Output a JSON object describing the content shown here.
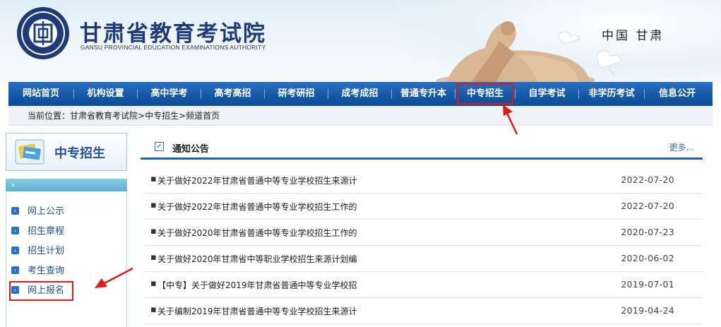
{
  "header": {
    "site_title": "甘肃省教育考试院",
    "site_subtitle": "GANSU PROVINCIAL EDUCATION EXAMINATIONS AUTHORITY",
    "region": "中国  甘肃",
    "logo_icon": "institution-seal-icon"
  },
  "nav": {
    "items": [
      {
        "label": "网站首页"
      },
      {
        "label": "机构设置"
      },
      {
        "label": "高中学考"
      },
      {
        "label": "高考高招"
      },
      {
        "label": "研考研招"
      },
      {
        "label": "成考成招"
      },
      {
        "label": "普通专升本"
      },
      {
        "label": "中专招生"
      },
      {
        "label": "自学考试"
      },
      {
        "label": "非学历考试"
      },
      {
        "label": "信息公开"
      }
    ],
    "active_index": 7
  },
  "breadcrumb": {
    "prefix": "当前位置：",
    "trail": "甘肃省教育考试院>中专招生>频道首页"
  },
  "sidebar": {
    "title": "中专招生",
    "items": [
      {
        "label": "网上公示"
      },
      {
        "label": "招生章程"
      },
      {
        "label": "招生计划"
      },
      {
        "label": "考生查询"
      },
      {
        "label": "网上报名"
      }
    ],
    "highlight_index": 4
  },
  "notices": {
    "title": "通知公告",
    "more": "更多...",
    "rows": [
      {
        "title": "关于做好2022年甘肃省普通中等专业学校招生来源计",
        "date": "2022-07-20"
      },
      {
        "title": "关于做好2022年甘肃省普通中等专业学校招生工作的",
        "date": "2022-07-20"
      },
      {
        "title": "关于做好2020年甘肃省普通中等专业学校招生工作的",
        "date": "2020-07-23"
      },
      {
        "title": "关于做好2020年甘肃省中等职业学校招生来源计划编",
        "date": "2020-06-02"
      },
      {
        "title": "【中专】关于做好2019年甘肃省普通中等专业学校招",
        "date": "2019-07-01"
      },
      {
        "title": "关于编制2019年甘肃省普通中等专业学校招生来源计",
        "date": "2019-04-24"
      }
    ]
  },
  "colors": {
    "nav_blue": "#1559a8",
    "title_blue": "#1f3a78",
    "annotation_red": "#e01818"
  }
}
